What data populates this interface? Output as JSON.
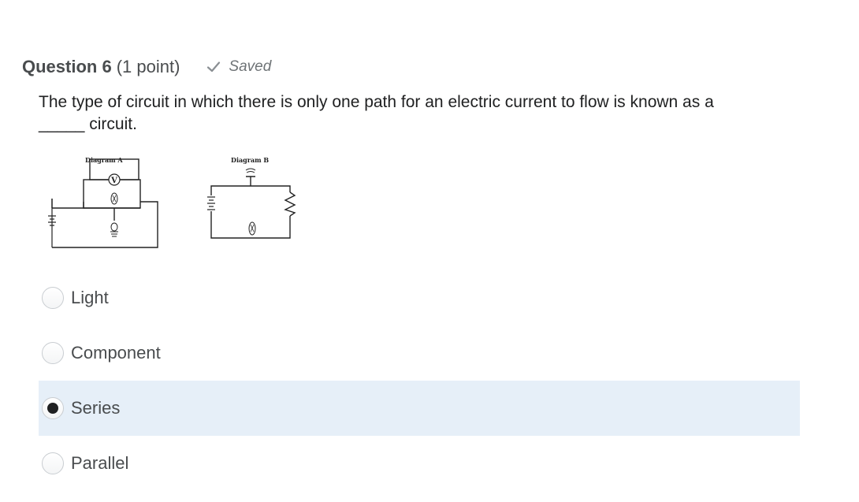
{
  "question": {
    "number_label": "Question 6",
    "points_label": "(1 point)",
    "status_label": "Saved",
    "prompt_line1": "The type of circuit in which there is only one path for an electric current to flow is known as a",
    "prompt_line2": "_____ circuit."
  },
  "diagrams": {
    "diagram_a_label": "Diagram A",
    "diagram_a_meter": "V",
    "diagram_b_label": "Diagram B"
  },
  "options": [
    {
      "label": "Light",
      "selected": false
    },
    {
      "label": "Component",
      "selected": false
    },
    {
      "label": "Series",
      "selected": true
    },
    {
      "label": "Parallel",
      "selected": false
    }
  ],
  "colors": {
    "selected_row_bg": "#e6eff8",
    "check_mark": "#8a8f93"
  }
}
